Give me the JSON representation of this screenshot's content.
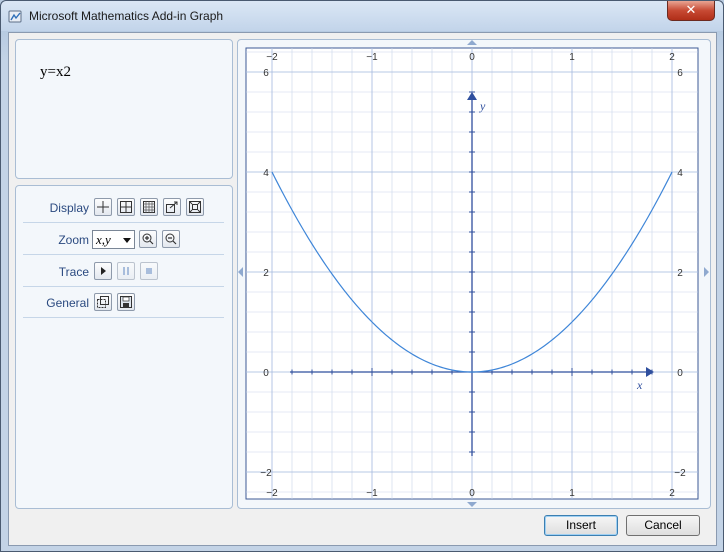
{
  "window": {
    "title": "Microsoft Mathematics Add-in Graph",
    "close_label": "✕"
  },
  "equation": "y=x2",
  "toolbar": {
    "display_label": "Display",
    "zoom_label": "Zoom",
    "zoom_value": "x,y",
    "trace_label": "Trace",
    "general_label": "General"
  },
  "graph": {
    "x_axis_label": "x",
    "y_axis_label": "y",
    "x_ticks": [
      "−2",
      "−1",
      "0",
      "1",
      "2"
    ],
    "y_ticks": [
      "6",
      "4",
      "2",
      "0",
      "−2"
    ],
    "xlim": [
      -2,
      2
    ],
    "ylim": [
      -2,
      6
    ],
    "curve_color": "#3f86d8",
    "axis_color": "#2f4f9e",
    "grid_color": "#c9d6ea"
  },
  "buttons": {
    "insert": "Insert",
    "cancel": "Cancel"
  },
  "chart_data": {
    "type": "line",
    "title": "",
    "xlabel": "x",
    "ylabel": "y",
    "xlim": [
      -2,
      2
    ],
    "ylim": [
      -2,
      6
    ],
    "grid": true,
    "series": [
      {
        "x": [
          -2,
          -1.5,
          -1,
          -0.5,
          0,
          0.5,
          1,
          1.5,
          2
        ],
        "y": [
          4,
          2.25,
          1,
          0.25,
          0,
          0.25,
          1,
          2.25,
          4
        ]
      }
    ]
  }
}
